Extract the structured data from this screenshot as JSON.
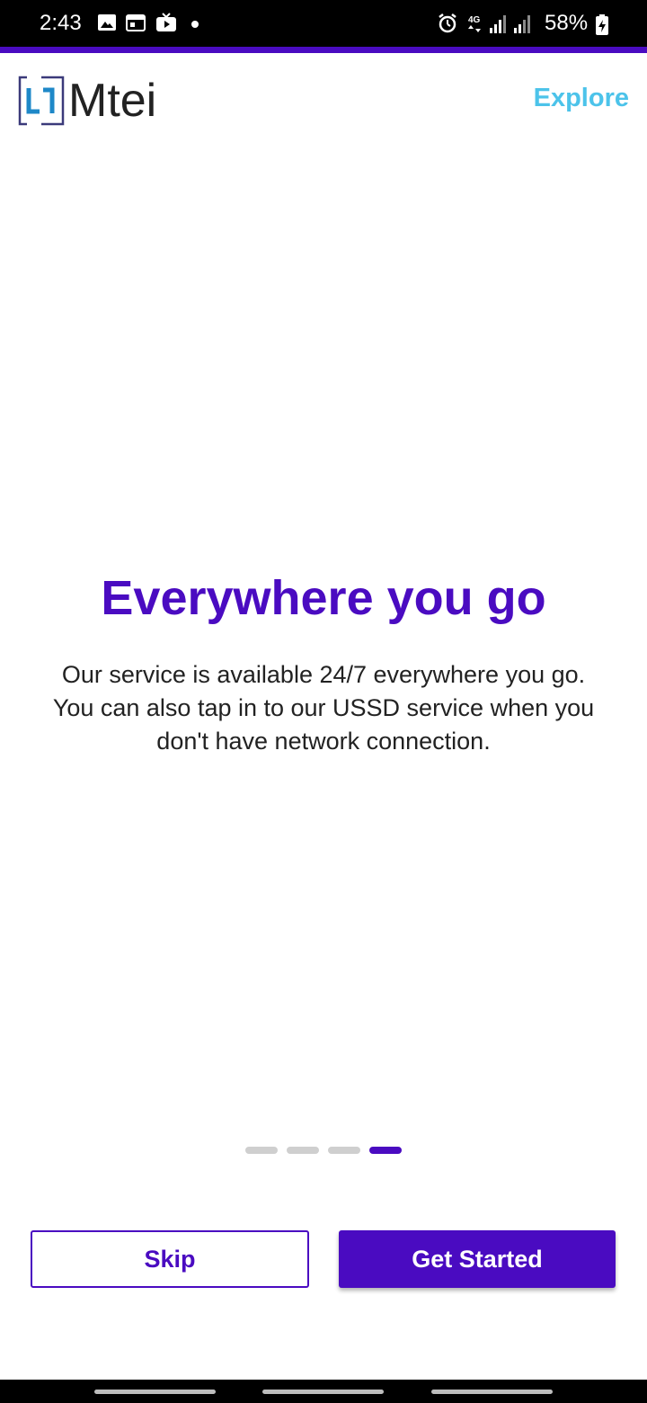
{
  "status_bar": {
    "time": "2:43",
    "battery": "58%",
    "icons": [
      "image-icon",
      "calendar-icon",
      "tv-icon",
      "dot-icon",
      "alarm-icon",
      "4g-icon",
      "signal-icon",
      "signal-icon-2",
      "battery-icon"
    ]
  },
  "header": {
    "brand": "Mtei",
    "explore_label": "Explore"
  },
  "content": {
    "headline": "Everywhere you go",
    "body": "Our service is available 24/7 everywhere you go. You can also tap in to our USSD service when you don't have network connection."
  },
  "pager": {
    "total": 4,
    "active_index": 3
  },
  "buttons": {
    "skip_label": "Skip",
    "start_label": "Get Started"
  },
  "colors": {
    "primary": "#4a0bc1",
    "link": "#4cc3ea",
    "inactive_dot": "#cfcfcf"
  }
}
